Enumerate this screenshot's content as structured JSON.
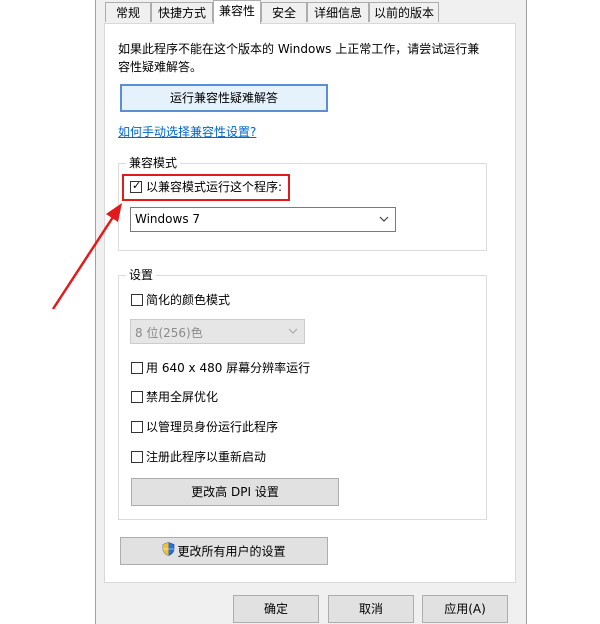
{
  "tabs": [
    "常规",
    "快捷方式",
    "兼容性",
    "安全",
    "详细信息",
    "以前的版本"
  ],
  "intro": {
    "line1": "如果此程序不能在这个版本的 Windows 上正常工作，请尝试运行兼",
    "line2": "容性疑难解答。"
  },
  "troubleshoot_button": "运行兼容性疑难解答",
  "manual_link": "如何手动选择兼容性设置?",
  "compat_mode": {
    "group_title": "兼容模式",
    "checkbox_label": "以兼容模式运行这个程序:",
    "checked": true,
    "selected_os": "Windows 7"
  },
  "settings": {
    "group_title": "设置",
    "reduced_color": {
      "label": "简化的颜色模式",
      "checked": false
    },
    "color_select": "8 位(256)色",
    "res_640": {
      "label": "用 640 x 480 屏幕分辨率运行",
      "checked": false
    },
    "fullscreen_opt": {
      "label": "禁用全屏优化",
      "checked": false
    },
    "run_as_admin": {
      "label": "以管理员身份运行此程序",
      "checked": false
    },
    "register_restart": {
      "label": "注册此程序以重新启动",
      "checked": false
    },
    "dpi_button": "更改高 DPI 设置"
  },
  "all_users_button": "更改所有用户的设置",
  "footer": {
    "ok": "确定",
    "cancel": "取消",
    "apply": "应用(A)"
  },
  "colors": {
    "highlight": "#e11b1b",
    "arrow": "#e11b1b",
    "link": "#0066cc"
  }
}
